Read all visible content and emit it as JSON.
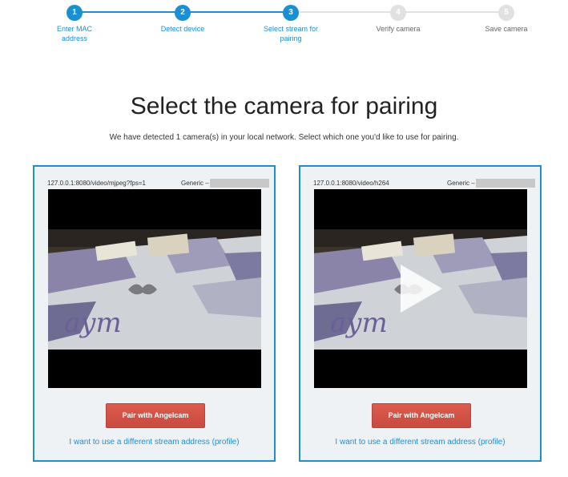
{
  "stepper": {
    "steps": [
      {
        "number": "1",
        "label": "Enter MAC address",
        "state": "done"
      },
      {
        "number": "2",
        "label": "Detect device",
        "state": "done"
      },
      {
        "number": "3",
        "label": "Select stream for pairing",
        "state": "current"
      },
      {
        "number": "4",
        "label": "Verify camera",
        "state": "pending"
      },
      {
        "number": "5",
        "label": "Save camera",
        "state": "pending"
      }
    ],
    "colors": {
      "active": "#1a8fd4",
      "inactive": "#e1e1e1"
    }
  },
  "page": {
    "title": "Select the camera for pairing",
    "subtitle": "We have detected 1 camera(s) in your local network. Select which one you'd like to use for pairing."
  },
  "cards": [
    {
      "stream_url": "127.0.0.1:8080/video/mjpeg?fps=1",
      "vendor": "Generic –",
      "preview": "playing",
      "pair_label": "Pair with Angelcam",
      "alt_link": "I want to use a different stream address (profile)"
    },
    {
      "stream_url": "127.0.0.1:8080/video/h264",
      "vendor": "Generic –",
      "preview": "paused-play-icon",
      "pair_label": "Pair with Angelcam",
      "alt_link": "I want to use a different stream address (profile)"
    }
  ],
  "theme": {
    "accent": "#1a8fd4",
    "button": "#d9534f",
    "card_bg": "#eef2f5"
  }
}
